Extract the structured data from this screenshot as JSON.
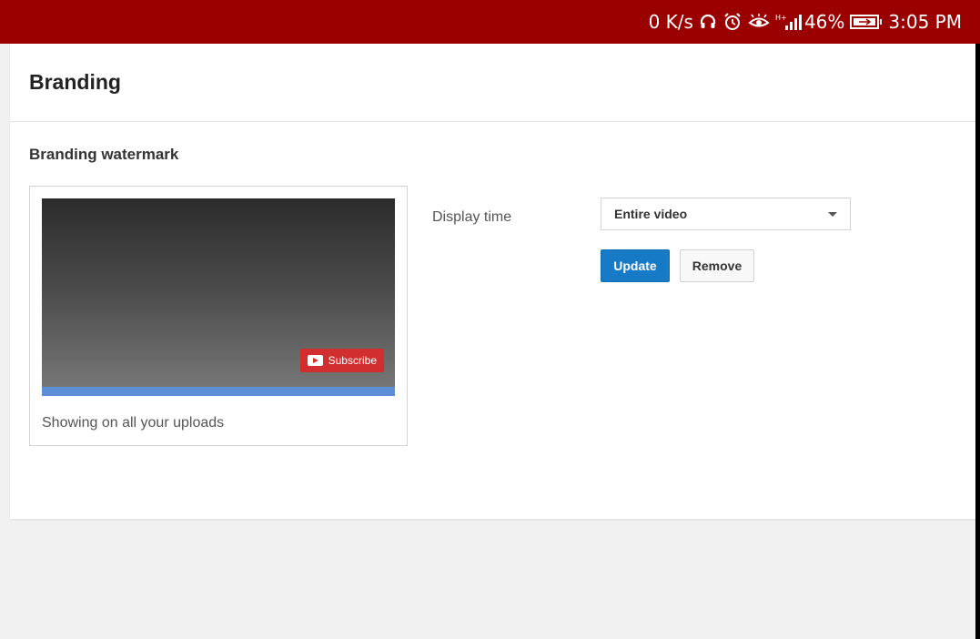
{
  "status_bar": {
    "speed": "0 K/s",
    "network": "H+",
    "battery": "46%",
    "time": "3:05 PM",
    "icons": [
      "headphones-icon",
      "alarm-icon",
      "eye-icon",
      "signal-icon",
      "battery-icon"
    ]
  },
  "page": {
    "title": "Branding"
  },
  "watermark": {
    "section_title": "Branding watermark",
    "subscribe_label": "Subscribe",
    "caption": "Showing on all your uploads"
  },
  "settings": {
    "display_time_label": "Display time",
    "display_time_value": "Entire video",
    "update_label": "Update",
    "remove_label": "Remove"
  },
  "colors": {
    "status_bar": "#9b0000",
    "update_button": "#167ac6",
    "subscribe": "#d12f2f"
  }
}
